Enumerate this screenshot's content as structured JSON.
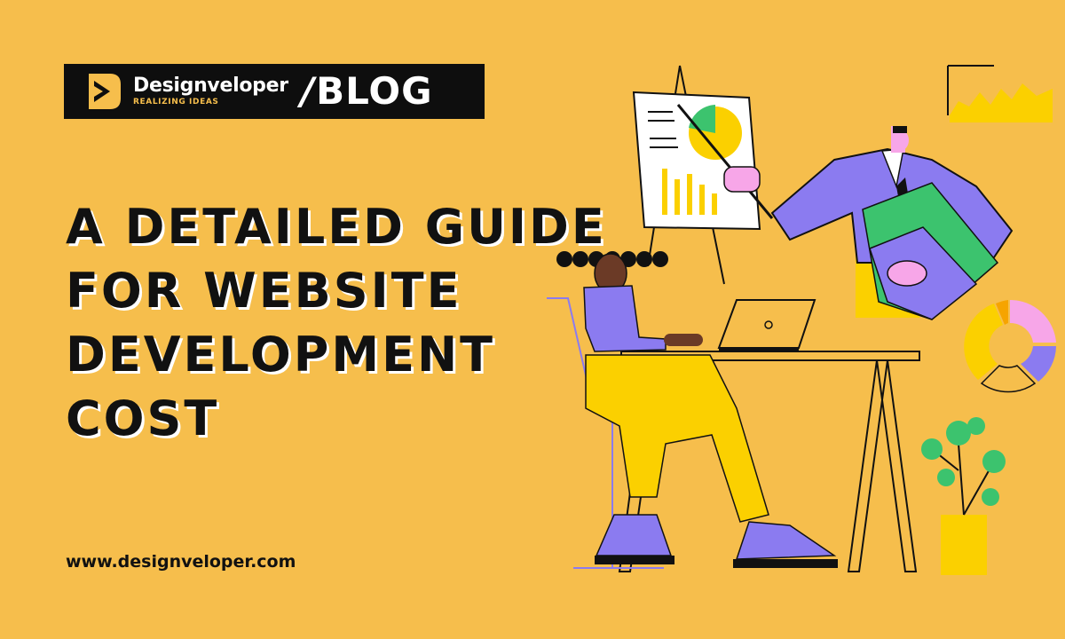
{
  "brand": {
    "name": "Designveloper",
    "tagline": "REALIZING IDEAS",
    "separator": "/",
    "section": "BLOG"
  },
  "headline": {
    "lines": [
      "A DETAILED GUIDE",
      "FOR WEBSITE",
      "DEVELOPMENT",
      "COST"
    ]
  },
  "footer": {
    "url": "www.designveloper.com"
  },
  "colors": {
    "background": "#F6BE4C",
    "brand_bar": "#0E0E0E",
    "accent_purple": "#8B7BF0",
    "accent_green": "#3CC36E",
    "accent_pink": "#F7A6E8",
    "accent_yellow": "#FBD000"
  },
  "icons": {
    "logo": "designveloper-logo-icon"
  }
}
